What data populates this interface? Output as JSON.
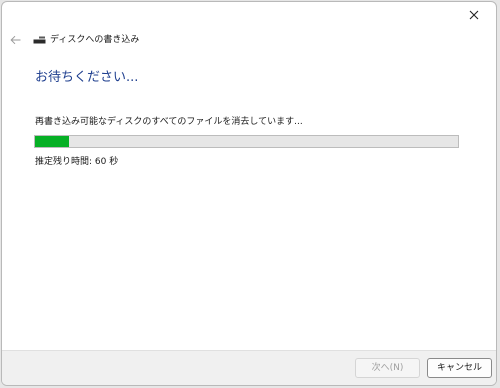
{
  "window": {
    "nav_title": "ディスクへの書き込み"
  },
  "icons": {
    "close": "close-icon",
    "back": "back-arrow-icon",
    "drive": "disc-drive-icon"
  },
  "main": {
    "heading": "お待ちください...",
    "status_text": "再書き込み可能なディスクのすべてのファイルを消去しています...",
    "progress_fraction": 0.08,
    "remaining_text": "推定残り時間: 60 秒"
  },
  "footer": {
    "next_label": "次へ(N)",
    "cancel_label": "キャンセル"
  },
  "colors": {
    "heading": "#1f3f8f",
    "progress_fill": "#06b025",
    "progress_track": "#e6e6e6"
  }
}
